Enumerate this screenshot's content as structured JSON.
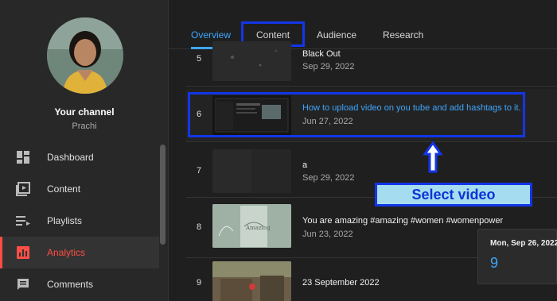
{
  "channel": {
    "title": "Your channel",
    "name": "Prachi"
  },
  "nav": [
    {
      "label": "Dashboard",
      "icon": "dashboard-icon"
    },
    {
      "label": "Content",
      "icon": "content-icon"
    },
    {
      "label": "Playlists",
      "icon": "playlists-icon"
    },
    {
      "label": "Analytics",
      "icon": "analytics-icon",
      "active": true
    },
    {
      "label": "Comments",
      "icon": "comments-icon"
    }
  ],
  "tabs": [
    {
      "label": "Overview",
      "active": true
    },
    {
      "label": "Content"
    },
    {
      "label": "Audience"
    },
    {
      "label": "Research"
    }
  ],
  "videos": [
    {
      "index": "5",
      "title": "Black Out",
      "date": "Sep 29, 2022"
    },
    {
      "index": "6",
      "title": "How to upload video on you tube and add hashtags to it.",
      "date": "Jun 27, 2022",
      "selected": true
    },
    {
      "index": "7",
      "title": "a",
      "date": "Sep 29, 2022"
    },
    {
      "index": "8",
      "title": "You are amazing #amazing #women #womenpower",
      "date": "Jun 23, 2022"
    },
    {
      "index": "9",
      "title": "23 September 2022",
      "date": ""
    }
  ],
  "annotation": {
    "label": "Select video"
  },
  "tooltip": {
    "date": "Mon, Sep 26, 2022",
    "value": "9"
  },
  "colors": {
    "accent": "#3ea6ff",
    "active_nav": "#ff4e45",
    "highlight_box": "#1336e8",
    "callout_bg": "#a6dcf0"
  }
}
